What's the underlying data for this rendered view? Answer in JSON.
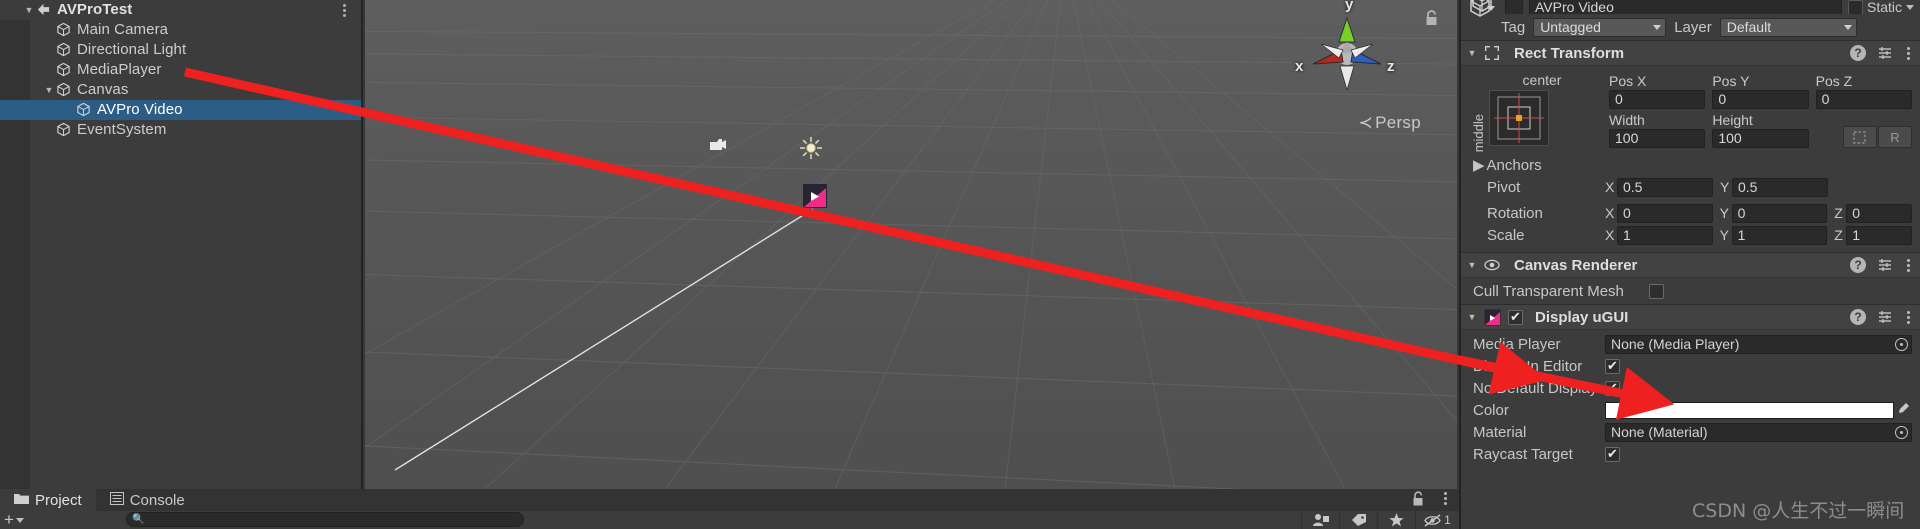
{
  "hierarchy": {
    "menu_icon": "kebab-menu-icon",
    "rows": [
      {
        "label": "AVProTest",
        "depth": 0,
        "fold": "open",
        "icon": "unity-scene-icon",
        "selected": false,
        "root": true
      },
      {
        "label": "Main Camera",
        "depth": 1,
        "fold": "none",
        "icon": "gameobject-icon",
        "selected": false,
        "root": false
      },
      {
        "label": "Directional Light",
        "depth": 1,
        "fold": "none",
        "icon": "gameobject-icon",
        "selected": false,
        "root": false
      },
      {
        "label": "MediaPlayer",
        "depth": 1,
        "fold": "none",
        "icon": "gameobject-icon",
        "selected": false,
        "root": false
      },
      {
        "label": "Canvas",
        "depth": 1,
        "fold": "open",
        "icon": "gameobject-icon",
        "selected": false,
        "root": false
      },
      {
        "label": "AVPro Video",
        "depth": 2,
        "fold": "none",
        "icon": "gameobject-icon",
        "selected": true,
        "root": false
      },
      {
        "label": "EventSystem",
        "depth": 1,
        "fold": "none",
        "icon": "gameobject-icon",
        "selected": false,
        "root": false
      }
    ],
    "selection_color": "#2c5d87"
  },
  "scene": {
    "projection_label": "Persp",
    "projection_arrow": "≺",
    "lock_icon": "lock-open-icon",
    "gizmo": {
      "x": "x",
      "y": "y",
      "z": "z",
      "x_color": "#b5291f",
      "y_color": "#7ccd2f",
      "z_color": "#2b5fc4"
    },
    "grid_color": "#6d6d6d",
    "background_color": "#5a5a5a"
  },
  "inspector": {
    "object_name": "AVPro Video",
    "static_label": "Static",
    "static_checked": false,
    "tag_label": "Tag",
    "tag_value": "Untagged",
    "layer_label": "Layer",
    "layer_value": "Default",
    "components": [
      {
        "title": "Rect Transform",
        "icon": "rect-transform-icon",
        "anchor_preset_h": "center",
        "anchor_preset_v": "middle",
        "fields": {
          "pos_x_label": "Pos X",
          "pos_x": "0",
          "pos_y_label": "Pos Y",
          "pos_y": "0",
          "pos_z_label": "Pos Z",
          "pos_z": "0",
          "width_label": "Width",
          "width": "100",
          "height_label": "Height",
          "height": "100",
          "blueprint_button": "blueprint-mode-icon",
          "raw_button": "R",
          "anchors_label": "Anchors",
          "pivot_label": "Pivot",
          "pivot_x": "0.5",
          "pivot_y": "0.5",
          "rotation_label": "Rotation",
          "rot_x": "0",
          "rot_y": "0",
          "rot_z": "0",
          "scale_label": "Scale",
          "scale_x": "1",
          "scale_y": "1",
          "scale_z": "1",
          "x_axis": "X",
          "y_axis": "Y",
          "z_axis": "Z"
        }
      },
      {
        "title": "Canvas Renderer",
        "icon": "canvas-renderer-icon",
        "cull_label": "Cull Transparent Mesh",
        "cull_checked": false
      },
      {
        "title": "Display uGUI",
        "icon": "avpro-display-icon",
        "enabled": true,
        "rows": [
          {
            "label": "Media Player",
            "type": "object",
            "value": "None (Media Player)"
          },
          {
            "label": "Display In Editor",
            "type": "checkbox",
            "checked": true
          },
          {
            "label": "No Default Display",
            "type": "checkbox",
            "checked": true
          },
          {
            "label": "Color",
            "type": "color",
            "value": "#ffffff"
          },
          {
            "label": "Material",
            "type": "object",
            "value": "None (Material)"
          },
          {
            "label": "Raycast Target",
            "type": "checkbox",
            "checked": true
          }
        ]
      }
    ],
    "header_icons": {
      "help": "help-icon",
      "preset": "preset-icon",
      "menu": "kebab-menu-icon"
    }
  },
  "bottom_bar": {
    "tabs": [
      {
        "label": "Project",
        "icon": "folder-icon",
        "active": true
      },
      {
        "label": "Console",
        "icon": "console-icon",
        "active": false
      }
    ],
    "add_button": "+",
    "search_placeholder": "",
    "search_icon": "search-icon",
    "toolbar_icons": [
      "packages-icon",
      "label-icon",
      "favorite-star-icon",
      "hidden-eye-icon"
    ],
    "hidden_count": "1",
    "lock_icon": "lock-open-icon",
    "menu_icon": "kebab-menu-icon"
  },
  "annotations": {
    "arrow_color": "#ef2020",
    "arrow_1": "arrow from MediaPlayer hierarchy item to Display uGUI Media Player field",
    "arrow_2": "arrow pointing at Media Player object field"
  },
  "watermark": {
    "text": "CSDN @人生不过一瞬间"
  }
}
